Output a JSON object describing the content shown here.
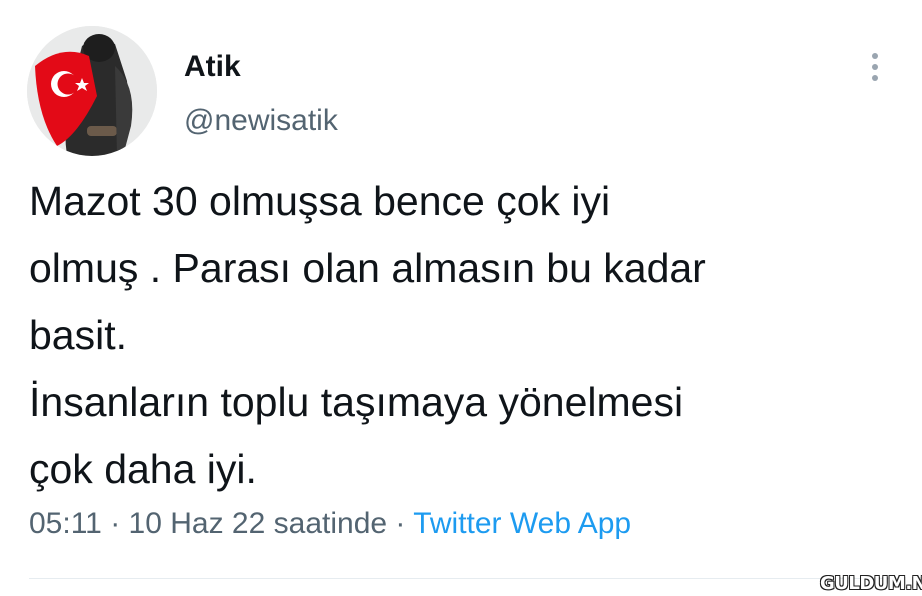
{
  "author": {
    "display_name": "Atik",
    "handle": "@newisatik"
  },
  "tweet": {
    "lines": [
      "Mazot 30 olmuşsa bence çok iyi",
      "olmuş . Parası olan almasın bu kadar",
      "basit.",
      "İnsanların toplu taşımaya yönelmesi",
      "çok daha iyi."
    ]
  },
  "meta": {
    "time": "05:11",
    "separator": "·",
    "date": "10 Haz 22 saatinde",
    "source": "Twitter Web App"
  },
  "watermark": "GULDUM.NET",
  "icons": {
    "more": "more-vertical-icon",
    "avatar": "avatar-image"
  },
  "colors": {
    "text": "#0f1419",
    "secondary": "#536471",
    "link": "#1d9bf0",
    "flag_red": "#e30a17"
  }
}
